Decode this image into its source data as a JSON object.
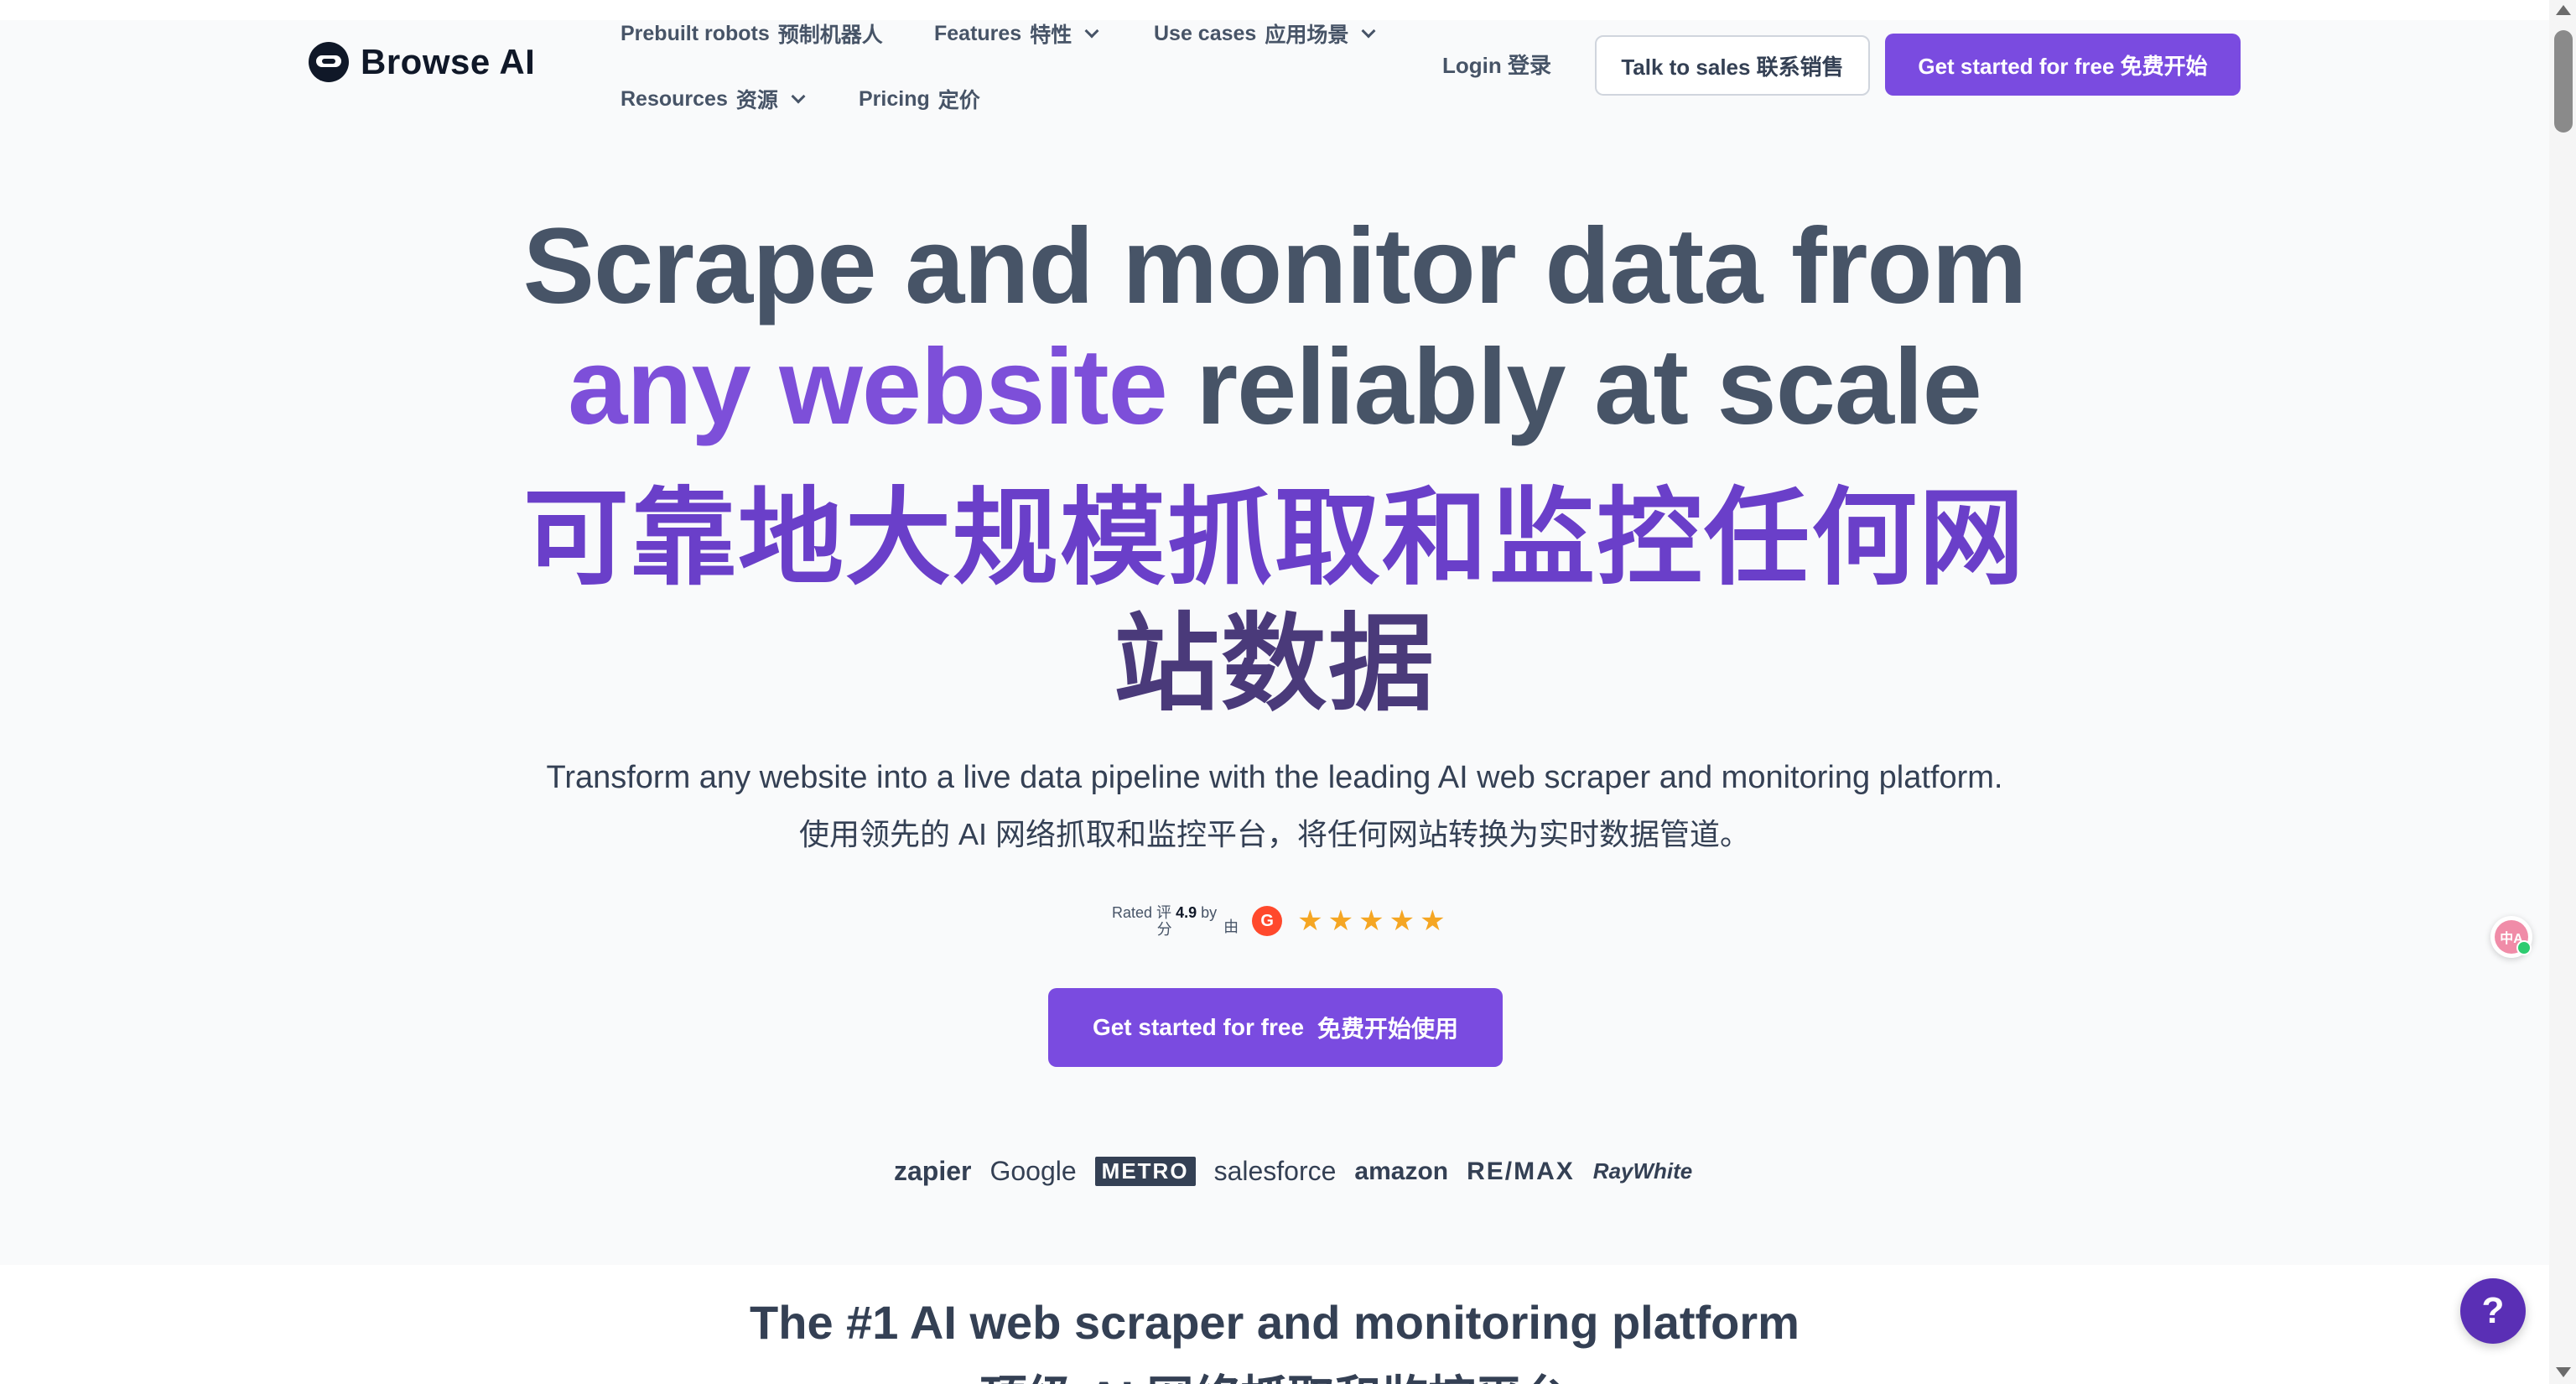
{
  "header": {
    "logo_text": "Browse AI",
    "nav": [
      {
        "en": "Prebuilt robots",
        "cn": "预制机器人",
        "dropdown": false
      },
      {
        "en": "Features",
        "cn": "特性",
        "dropdown": true
      },
      {
        "en": "Use cases",
        "cn": "应用场景",
        "dropdown": true
      },
      {
        "en": "Resources",
        "cn": "资源",
        "dropdown": true
      },
      {
        "en": "Pricing",
        "cn": "定价",
        "dropdown": false
      }
    ],
    "login": "Login  登录",
    "talk_to_sales": "Talk to sales  联系销售",
    "get_started": "Get started for free    免费开始"
  },
  "hero": {
    "line1": "Scrape and monitor data from",
    "line2_accent": "any website",
    "line2_rest": " reliably at scale",
    "line3": "可靠地大规模抓取和监控任何网",
    "line4": "站数据",
    "sub_en": "Transform any website into a live data pipeline with the leading AI web scraper and monitoring platform.",
    "sub_cn": "使用领先的 AI 网络抓取和监控平台，将任何网站转换为实时数据管道。",
    "rating": {
      "rated": "Rated 评",
      "score": "4.9",
      "by": "by",
      "fen": "分",
      "you": "由",
      "provider_icon": "g2-icon",
      "stars": 5
    },
    "cta": {
      "en": "Get started for free",
      "cn": "免费开始使用"
    }
  },
  "logos": [
    "zapier",
    "Google",
    "METRO",
    "salesforce",
    "amazon",
    "RE/MAX",
    "RayWhite"
  ],
  "section": {
    "title": "The #1 AI web scraper and monitoring platform",
    "subtitle": "顶级 AI 网络抓取和监控平台"
  },
  "widgets": {
    "translate_label": "中A",
    "help_label": "?"
  },
  "colors": {
    "primary": "#7a4be0",
    "accent_text": "#7d4fd9",
    "heading": "#475467",
    "background": "#f9fafb",
    "star": "#f5a623"
  }
}
